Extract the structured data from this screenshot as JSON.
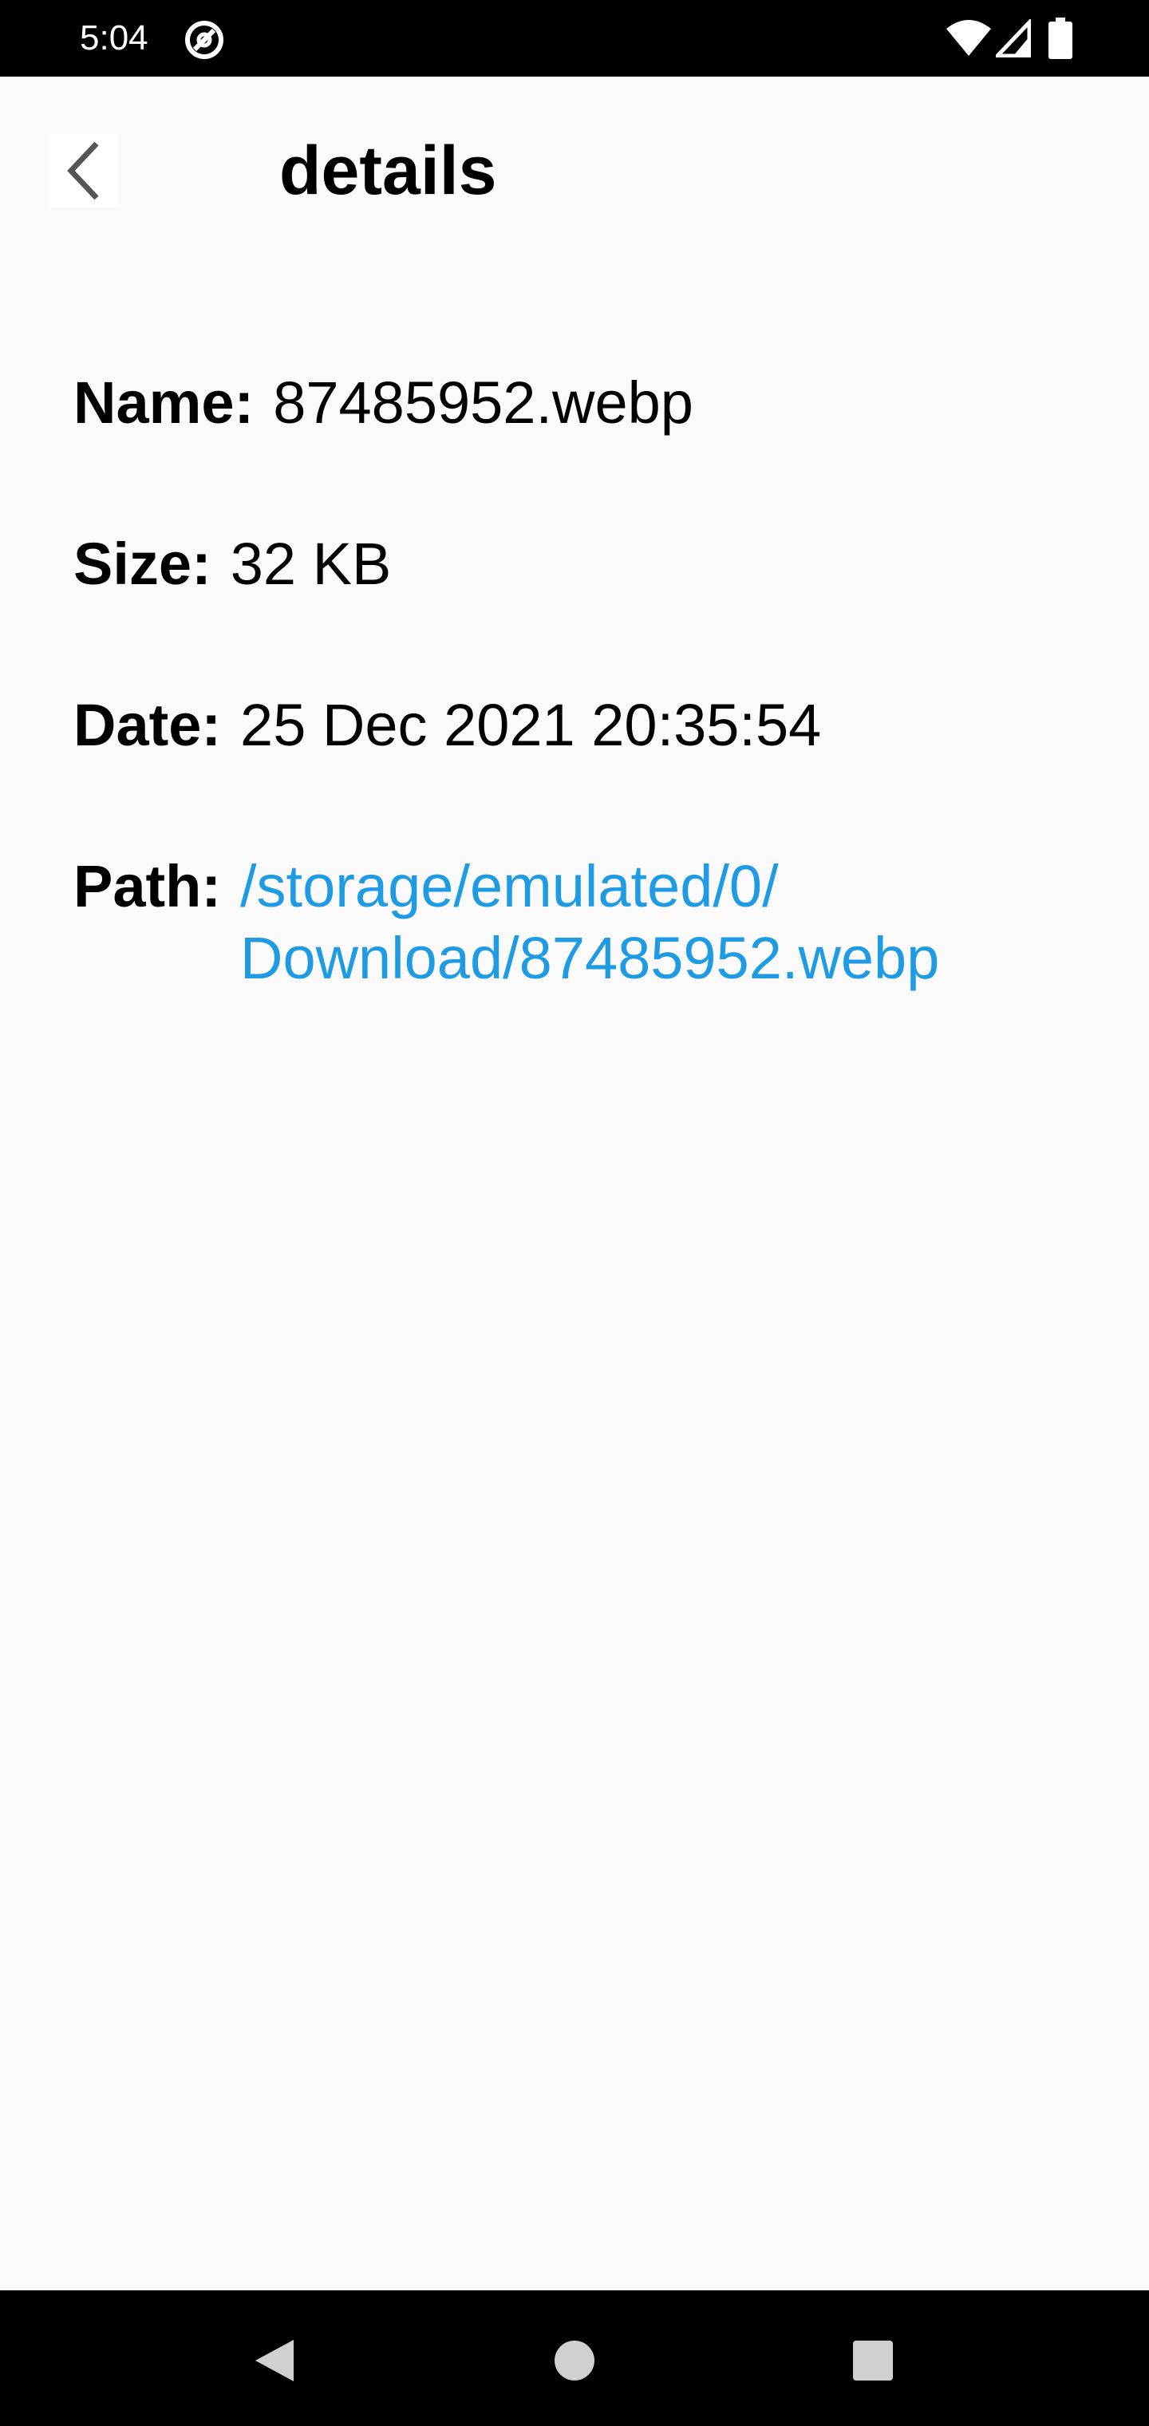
{
  "status_bar": {
    "time": "5:04",
    "icons": [
      "app-notification-icon",
      "wifi-icon",
      "signal-icon",
      "battery-icon"
    ]
  },
  "app_bar": {
    "back_icon": "chevron-left-icon",
    "title": "details"
  },
  "details": {
    "name_label": "Name:",
    "name_value": "87485952.webp",
    "size_label": "Size:",
    "size_value": "32 KB",
    "date_label": "Date:",
    "date_value": "25 Dec 2021 20:35:54",
    "path_label": "Path:",
    "path_value_line1": "/storage/emulated/0/",
    "path_value_line2": "Download/87485952.webp"
  },
  "nav_bar": {
    "icons": [
      "nav-back-icon",
      "nav-home-icon",
      "nav-recents-icon"
    ]
  },
  "colors": {
    "background": "#fafafa",
    "link": "#1e9be2",
    "status_bar": "#000000",
    "nav_bar": "#000000"
  }
}
